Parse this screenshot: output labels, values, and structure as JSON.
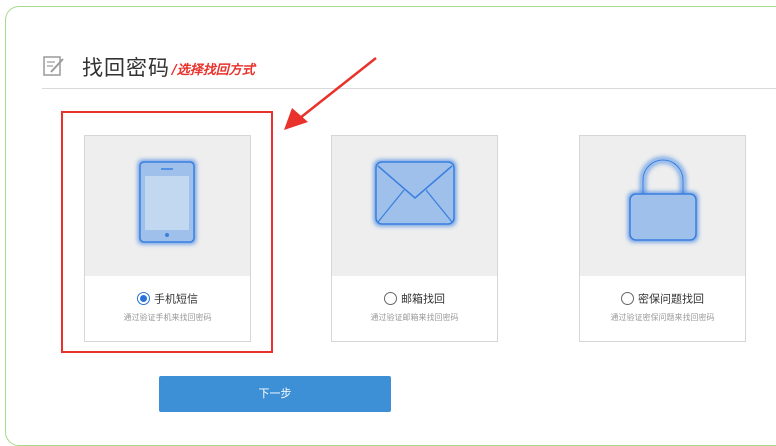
{
  "header": {
    "title": "找回密码",
    "subtitle": "/选择找回方式",
    "icon": "edit-note-icon"
  },
  "methods": [
    {
      "label": "手机短信",
      "desc": "通过验证手机来找回密码",
      "icon": "phone-icon",
      "selected": true
    },
    {
      "label": "邮箱找回",
      "desc": "通过验证邮箱来找回密码",
      "icon": "envelope-icon",
      "selected": false
    },
    {
      "label": "密保问题找回",
      "desc": "通过验证密保问题来找回密码",
      "icon": "lock-icon",
      "selected": false
    }
  ],
  "next_button": {
    "label": "下一步"
  },
  "colors": {
    "accent": "#2a72d8",
    "highlight": "#e8322b",
    "button": "#3d8fd6",
    "frame_border": "#a9d98a"
  }
}
